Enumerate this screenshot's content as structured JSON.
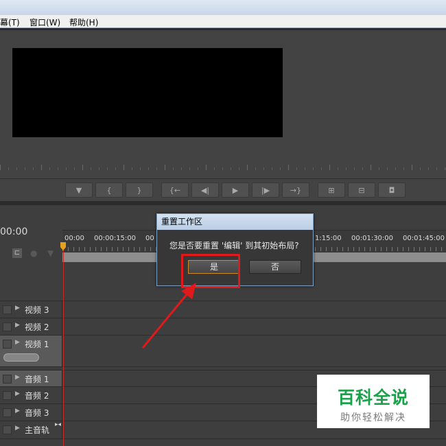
{
  "menubar": {
    "items": [
      {
        "label": "幕(T)"
      },
      {
        "label": "窗口(W)"
      },
      {
        "label": "帮助(H)"
      }
    ]
  },
  "monitor": {
    "controls": [
      {
        "icon": "marker-icon",
        "glyph": "▼"
      },
      {
        "icon": "mark-in-icon",
        "glyph": "{"
      },
      {
        "icon": "mark-out-icon",
        "glyph": "}"
      },
      {
        "icon": "go-to-in-icon",
        "glyph": "{←"
      },
      {
        "icon": "step-back-icon",
        "glyph": "◀|"
      },
      {
        "icon": "play-icon",
        "glyph": "▶"
      },
      {
        "icon": "step-forward-icon",
        "glyph": "|▶"
      },
      {
        "icon": "go-to-out-icon",
        "glyph": "→}"
      },
      {
        "icon": "lift-icon",
        "glyph": "⊞"
      },
      {
        "icon": "extract-icon",
        "glyph": "⊟"
      },
      {
        "icon": "camera-icon",
        "glyph": "◘"
      }
    ]
  },
  "timeline": {
    "timecode": "00:00",
    "ruler_labels": [
      "00:00",
      "00:00:15:00",
      "00",
      "1:15:00",
      "00:01:30:00",
      "00:01:45:00"
    ],
    "tracks": [
      {
        "label": "视频 3",
        "active": false
      },
      {
        "label": "视频 2",
        "active": false
      },
      {
        "label": "视频 1",
        "active": true
      },
      {
        "label": "音频 1",
        "active": true
      },
      {
        "label": "音频 2",
        "active": false
      },
      {
        "label": "音频 3",
        "active": false
      },
      {
        "label": "主音轨",
        "active": false
      }
    ]
  },
  "dialog": {
    "title": "重置工作区",
    "message": "您是否要重置 '编辑' 到其初始布局?",
    "yes_label": "是",
    "no_label": "否"
  },
  "annotation": {
    "highlight_color": "#e01a1a"
  },
  "watermark": {
    "title": "百科全说",
    "subtitle": "助你轻松解决"
  }
}
